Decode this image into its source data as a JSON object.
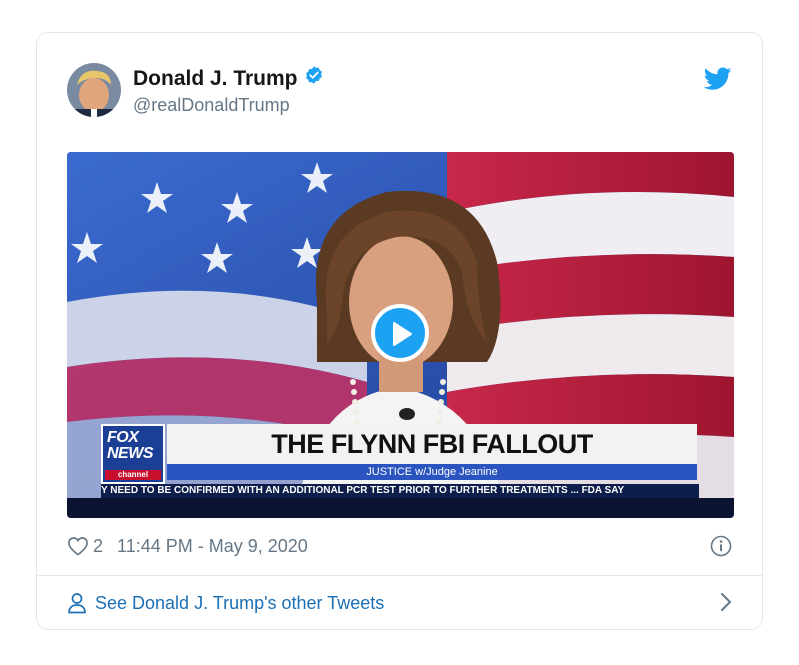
{
  "tweet": {
    "display_name": "Donald J. Trump",
    "handle": "@realDonaldTrump",
    "verified": true,
    "like_count": "2",
    "timestamp": "11:44 PM - May 9, 2020",
    "see_more_label": "See Donald J. Trump's other Tweets"
  },
  "video": {
    "logo_text": "FOX NEWS",
    "logo_channel": "channel",
    "headline": "THE FLYNN FBI FALLOUT",
    "subhead": "JUSTICE w/Judge Jeanine",
    "ticker": "Y NEED TO BE CONFIRMED WITH AN ADDITIONAL PCR TEST PRIOR TO FURTHER TREATMENTS  ...  FDA SAY"
  },
  "icons": {
    "verified": "verified-badge-icon",
    "twitter": "twitter-bird-icon",
    "play": "play-icon",
    "like": "heart-icon",
    "info": "info-icon",
    "person": "person-icon",
    "chevron": "chevron-right-icon"
  },
  "colors": {
    "twitter_blue": "#1da1f2",
    "link_blue": "#1b6fb5",
    "muted_text": "#657786",
    "name_text": "#14171a",
    "border": "#e1e8ed"
  }
}
